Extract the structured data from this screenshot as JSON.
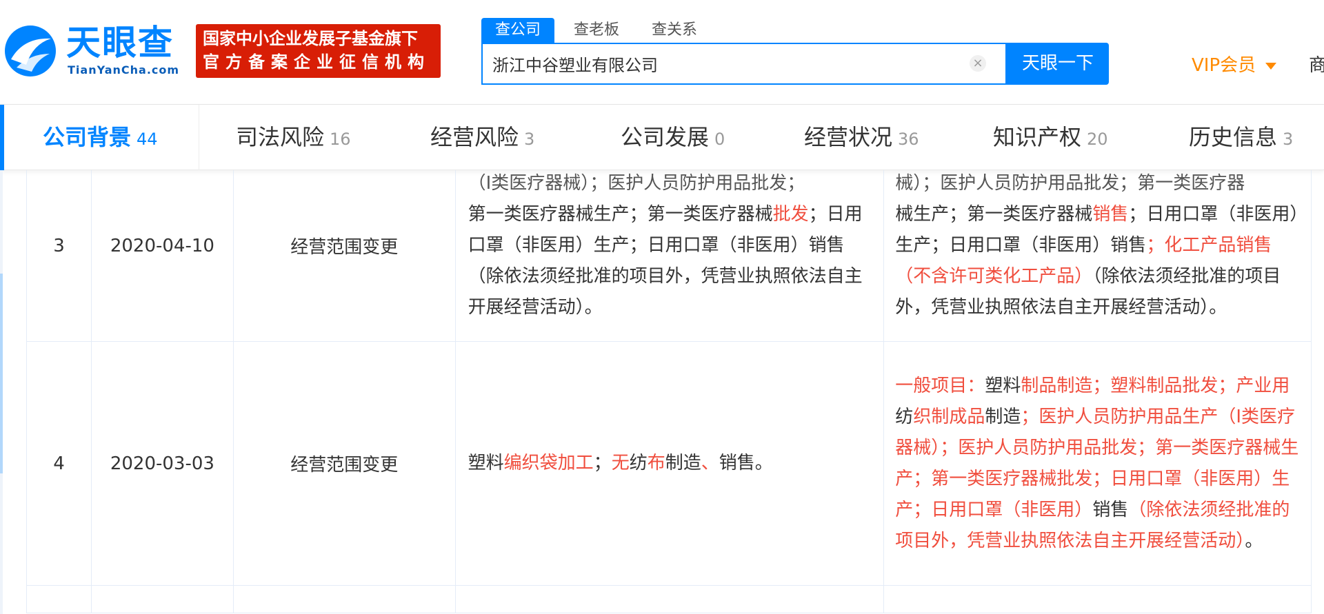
{
  "header": {
    "logo_cn": "天眼查",
    "logo_en": "TianYanCha.com",
    "badge_line1": "国家中小企业发展子基金旗下",
    "badge_line2": "官方备案企业征信机构",
    "search_tabs": [
      "查公司",
      "查老板",
      "查关系"
    ],
    "search_value": "浙江中谷塑业有限公司",
    "search_button": "天眼一下",
    "vip_label": "VIP会员",
    "cut_text": "商"
  },
  "nav": {
    "tabs": [
      {
        "label": "公司背景",
        "count": "44"
      },
      {
        "label": "司法风险",
        "count": "16"
      },
      {
        "label": "经营风险",
        "count": "3"
      },
      {
        "label": "公司发展",
        "count": "0"
      },
      {
        "label": "经营状况",
        "count": "36"
      },
      {
        "label": "知识产权",
        "count": "20"
      },
      {
        "label": "历史信息",
        "count": "3"
      }
    ]
  },
  "table": {
    "rows": [
      {
        "no": "3",
        "date": "2020-04-10",
        "item": "经营范围变更",
        "before_top": "（Ⅰ类医疗器械）；医护人员防护用品批发；",
        "before": [
          {
            "t": "第一类医疗器械生产；第一类医疗器械",
            "h": false
          },
          {
            "t": "批发",
            "h": true
          },
          {
            "t": "；日用口罩（非医用）生产；日用口罩（非医用）销售（除依法须经批准的项目外，凭营业执照依法自主开展经营活动）。",
            "h": false
          }
        ],
        "after_top": "械）；医护人员防护用品批发；第一类医疗器",
        "after": [
          {
            "t": "械生产；第一类医疗器械",
            "h": false
          },
          {
            "t": "销售",
            "h": true
          },
          {
            "t": "；日用口罩（非医用）生产；日用口罩（非医用）销售",
            "h": false
          },
          {
            "t": "；化工产品销售（不含许可类化工产品）",
            "h": true
          },
          {
            "t": "（除依法须经批准的项目外，凭营业执照依法自主开展经营活动）。",
            "h": false
          }
        ]
      },
      {
        "no": "4",
        "date": "2020-03-03",
        "item": "经营范围变更",
        "before": [
          {
            "t": "塑料",
            "h": false
          },
          {
            "t": "编织袋加工",
            "h": true
          },
          {
            "t": "；",
            "h": false
          },
          {
            "t": "无",
            "h": true
          },
          {
            "t": "纺",
            "h": false
          },
          {
            "t": "布",
            "h": true
          },
          {
            "t": "制造",
            "h": false
          },
          {
            "t": "、",
            "h": true
          },
          {
            "t": "销售。",
            "h": false
          }
        ],
        "after": [
          {
            "t": "一般项目：",
            "h": true
          },
          {
            "t": "塑料",
            "h": false
          },
          {
            "t": "制品制造；塑料制品批发；产业用",
            "h": true
          },
          {
            "t": "纺",
            "h": false
          },
          {
            "t": "织制成品",
            "h": true
          },
          {
            "t": "制造",
            "h": false
          },
          {
            "t": "；医护人员防护用品生产（Ⅰ类医疗器械）；医护人员防护用品批发；第一类医疗器械生产；第一类医疗器械批发；日用口罩（非医用）生产；日用口罩（非医用）",
            "h": true
          },
          {
            "t": "销售",
            "h": false
          },
          {
            "t": "（除依法须经批准的项目外，凭营业执照依法自主开展经营活动）",
            "h": true
          },
          {
            "t": "。",
            "h": false
          }
        ]
      }
    ]
  },
  "colors": {
    "brand": "#0084ff",
    "badge": "#d81e06",
    "vip": "#ff8a00",
    "highlight": "#f04e3e"
  }
}
